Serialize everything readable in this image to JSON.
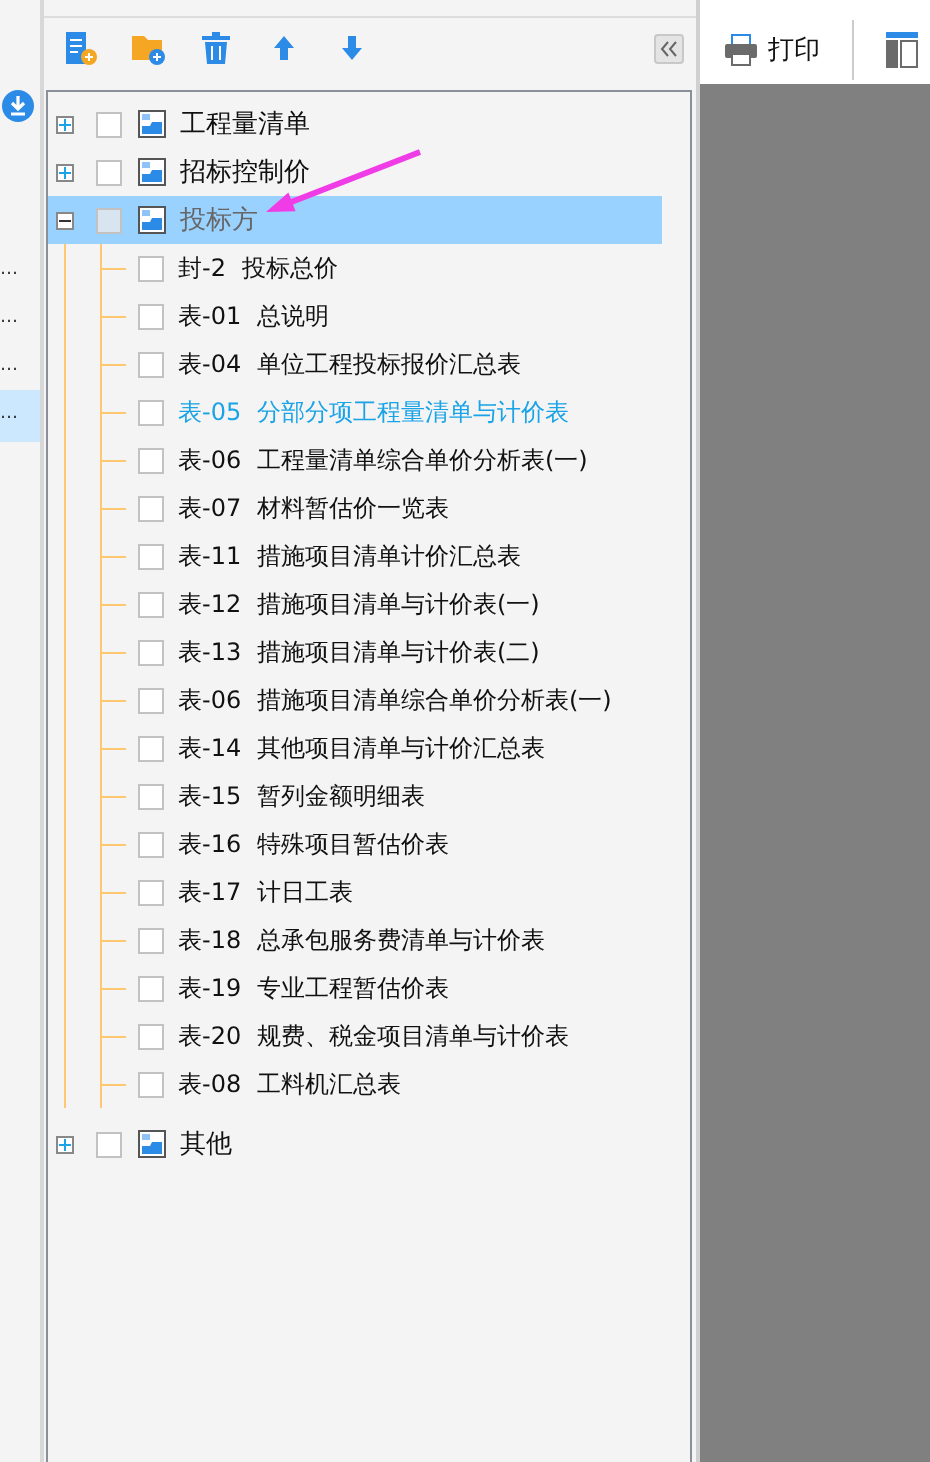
{
  "left_strip": {
    "items": [
      {
        "text": "…",
        "selected": false
      },
      {
        "text": "…",
        "selected": false
      },
      {
        "text": "…",
        "selected": false
      },
      {
        "text": "…",
        "selected": true
      }
    ]
  },
  "tree": {
    "roots": [
      {
        "label": "工程量清单",
        "expanded": false,
        "checked": false,
        "selected": false
      },
      {
        "label": "招标控制价",
        "expanded": false,
        "checked": false,
        "selected": false
      },
      {
        "label": "投标方",
        "expanded": true,
        "checked": false,
        "selected": true,
        "children": [
          {
            "code": "封-2",
            "label": "投标总价",
            "checked": false,
            "highlighted": false
          },
          {
            "code": "表-01",
            "label": "总说明",
            "checked": false,
            "highlighted": false
          },
          {
            "code": "表-04",
            "label": "单位工程投标报价汇总表",
            "checked": false,
            "highlighted": false
          },
          {
            "code": "表-05",
            "label": "分部分项工程量清单与计价表",
            "checked": false,
            "highlighted": true
          },
          {
            "code": "表-06",
            "label": "工程量清单综合单价分析表(一)",
            "checked": false,
            "highlighted": false
          },
          {
            "code": "表-07",
            "label": "材料暂估价一览表",
            "checked": false,
            "highlighted": false
          },
          {
            "code": "表-11",
            "label": "措施项目清单计价汇总表",
            "checked": false,
            "highlighted": false
          },
          {
            "code": "表-12",
            "label": "措施项目清单与计价表(一)",
            "checked": false,
            "highlighted": false
          },
          {
            "code": "表-13",
            "label": "措施项目清单与计价表(二)",
            "checked": false,
            "highlighted": false
          },
          {
            "code": "表-06",
            "label": "措施项目清单综合单价分析表(一)",
            "checked": false,
            "highlighted": false
          },
          {
            "code": "表-14",
            "label": "其他项目清单与计价汇总表",
            "checked": false,
            "highlighted": false
          },
          {
            "code": "表-15",
            "label": "暂列金额明细表",
            "checked": false,
            "highlighted": false
          },
          {
            "code": "表-16",
            "label": "特殊项目暂估价表",
            "checked": false,
            "highlighted": false
          },
          {
            "code": "表-17",
            "label": "计日工表",
            "checked": false,
            "highlighted": false
          },
          {
            "code": "表-18",
            "label": "总承包服务费清单与计价表",
            "checked": false,
            "highlighted": false
          },
          {
            "code": "表-19",
            "label": "专业工程暂估价表",
            "checked": false,
            "highlighted": false
          },
          {
            "code": "表-20",
            "label": "规费、税金项目清单与计价表",
            "checked": false,
            "highlighted": false
          },
          {
            "code": "表-08",
            "label": "工料机汇总表",
            "checked": false,
            "highlighted": false
          }
        ]
      },
      {
        "label": "其他",
        "expanded": false,
        "checked": false,
        "selected": false
      }
    ]
  },
  "preview_toolbar": {
    "print_button": "打印"
  }
}
